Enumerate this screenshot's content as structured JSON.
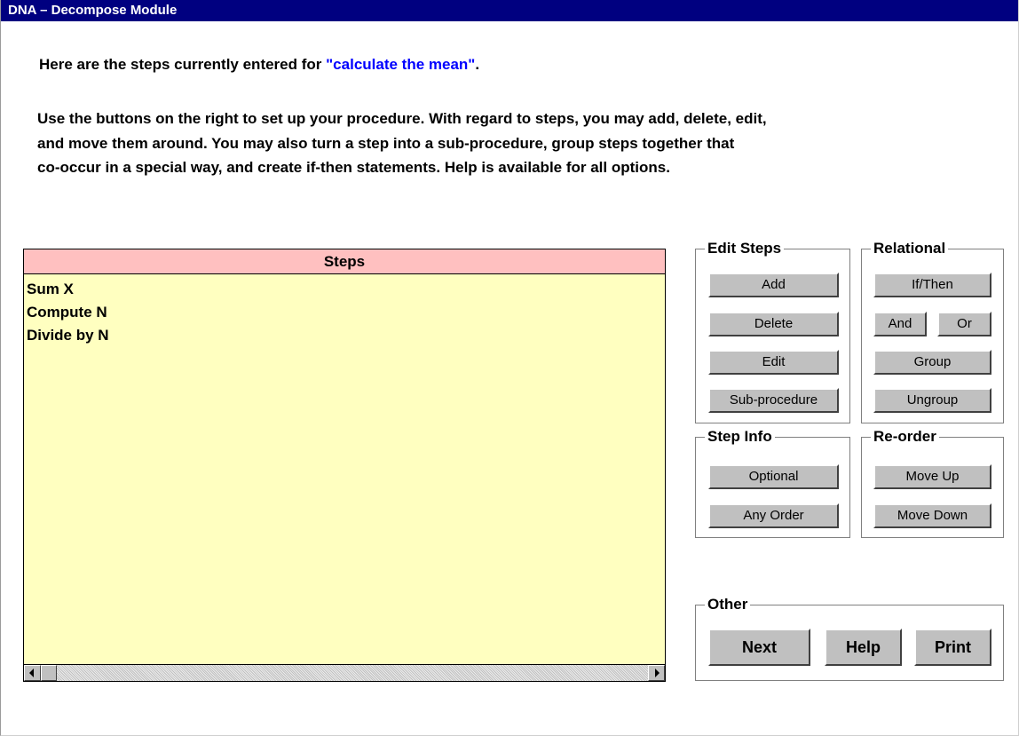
{
  "window": {
    "title": "DNA – Decompose Module"
  },
  "intro": {
    "prefix": "Here are the steps currently entered for ",
    "task": "\"calculate the mean\"",
    "suffix": "."
  },
  "instructions": [
    "Use the buttons on the right to set up your procedure. With regard to steps, you may add, delete, edit,",
    "and move them around. You may also turn a step into a sub-procedure, group steps together that",
    "co-occur in a special way, and create if-then statements. Help is available for all options."
  ],
  "steps_panel": {
    "header": "Steps",
    "items": [
      "Sum X",
      "Compute N",
      "Divide by N"
    ],
    "scroll_left_icon": "arrow-left-icon",
    "scroll_right_icon": "arrow-right-icon"
  },
  "edit_steps": {
    "label": "Edit Steps",
    "add": "Add",
    "delete": "Delete",
    "edit": "Edit",
    "subprocedure": "Sub-procedure"
  },
  "relational": {
    "label": "Relational",
    "if_then": "If/Then",
    "and": "And",
    "or": "Or",
    "group": "Group",
    "ungroup": "Ungroup"
  },
  "step_info": {
    "label": "Step Info",
    "optional": "Optional",
    "any_order": "Any Order"
  },
  "reorder": {
    "label": "Re-order",
    "move_up": "Move Up",
    "move_down": "Move Down"
  },
  "other": {
    "label": "Other",
    "next": "Next",
    "help": "Help",
    "print": "Print"
  },
  "colors": {
    "titlebar": "#000080",
    "highlight_text": "#0000ff",
    "steps_header_bg": "#ffc0c0",
    "steps_list_bg": "#ffffc0",
    "button_face": "#c0c0c0"
  }
}
